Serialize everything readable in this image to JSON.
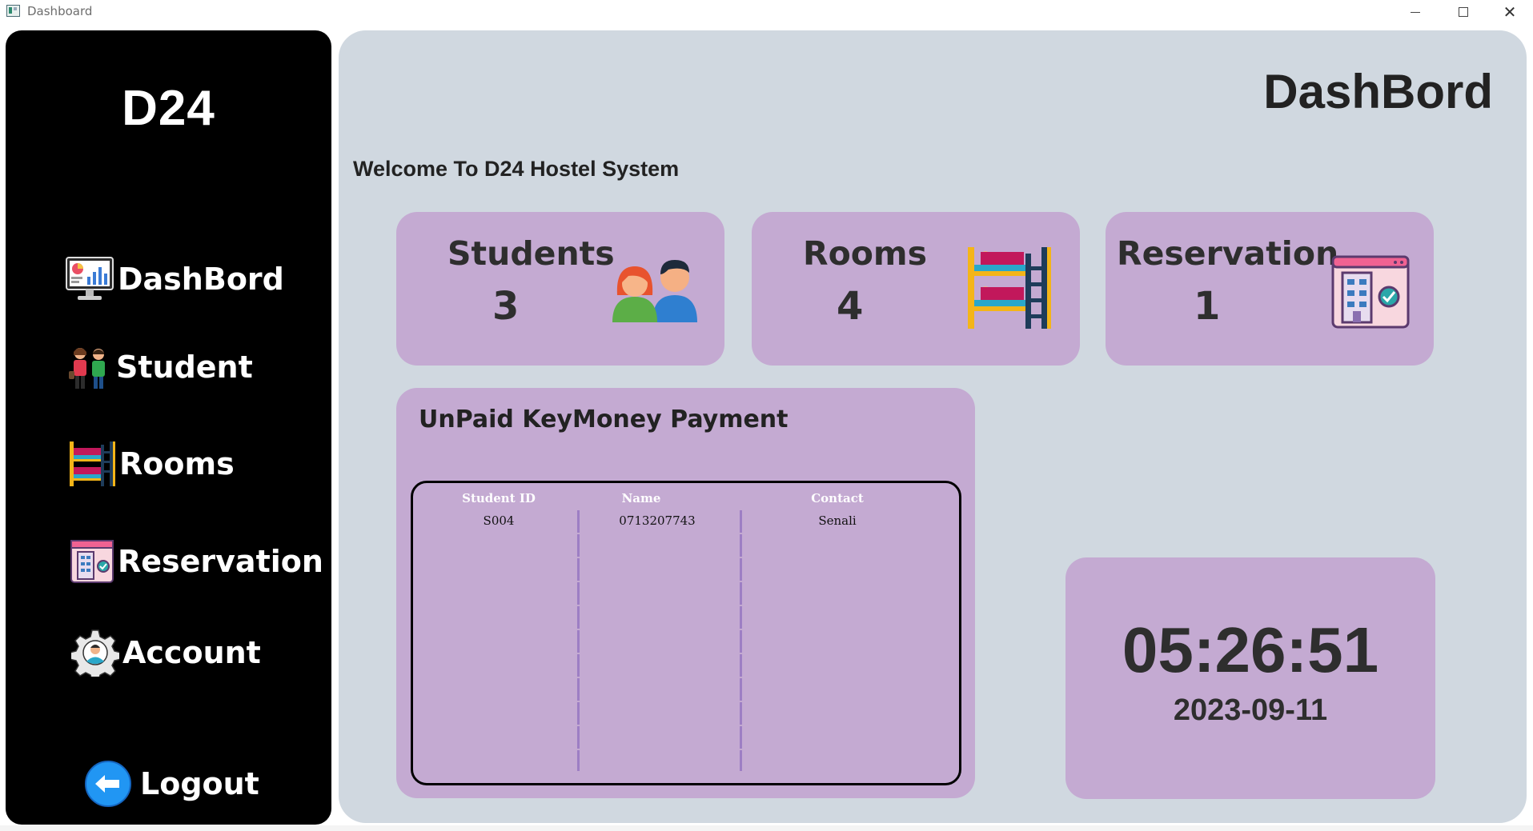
{
  "window": {
    "title": "Dashboard",
    "controls": {
      "minimize": "minimize",
      "maximize": "maximize",
      "close": "✕"
    }
  },
  "sidebar": {
    "brand": "D24",
    "items": [
      {
        "label": "DashBord",
        "icon": "dashboard-monitor-icon"
      },
      {
        "label": "Student",
        "icon": "students-icon"
      },
      {
        "label": "Rooms",
        "icon": "bunk-bed-icon"
      },
      {
        "label": "Reservation",
        "icon": "reservation-icon"
      },
      {
        "label": "Account",
        "icon": "account-gear-icon"
      }
    ],
    "logout": {
      "label": "Logout",
      "icon": "back-arrow-icon"
    }
  },
  "main": {
    "title": "DashBord",
    "welcome": "Welcome To D24 Hostel System",
    "cards": [
      {
        "title": "Students",
        "count": "3",
        "icon": "students-icon"
      },
      {
        "title": "Rooms",
        "count": "4",
        "icon": "bunk-bed-icon"
      },
      {
        "title": "Reservation",
        "count": "1",
        "icon": "reservation-icon"
      }
    ],
    "unpaid": {
      "title": "UnPaid KeyMoney Payment",
      "columns": [
        "Student ID",
        "Name",
        "Contact"
      ],
      "rows": [
        [
          "S004",
          "0713207743",
          "Senali"
        ]
      ]
    },
    "clock": {
      "time": "05:26:51",
      "date": "2023-09-11"
    }
  },
  "colors": {
    "sidebar_bg": "#000000",
    "main_bg": "#d0d8e0",
    "card_bg": "#c4aad2",
    "text_dark": "#2e2e2e",
    "separator": "#9d7ec4"
  }
}
